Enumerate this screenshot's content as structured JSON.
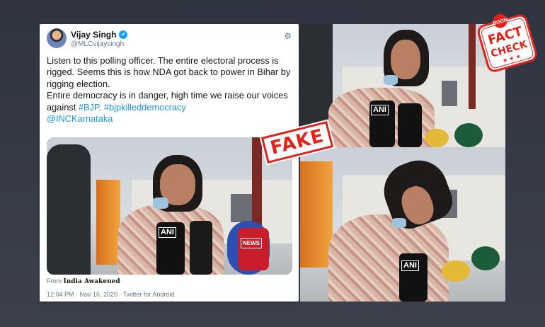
{
  "tweet": {
    "display_name": "Vijay Singh",
    "handle": "@MLCvijaysingh",
    "text_lines": [
      "Listen to this polling officer. The entire electoral process is rigged. Seems this is how NDA got back to power in Bihar by rigging election.",
      "Entire democracy is in danger, high time we raise our voices against "
    ],
    "hashtags": [
      "#BJP",
      "#bjpkilleddemocracy"
    ],
    "mention": "@INCKarnataka",
    "source_prefix": "From",
    "source_name": "India Awakened",
    "timestamp": "12:04 PM · Nov 16, 2020 · Twitter for Android"
  },
  "mic_labels": {
    "ani": "ANI",
    "news": "NEWS"
  },
  "stamp": {
    "fake": "FAKE"
  },
  "logo": {
    "boom": "BOOM",
    "fact": "FACT",
    "check": "CHECK"
  },
  "colors": {
    "brand_red": "#e0241b",
    "link_blue": "#1b95e0",
    "verified_blue": "#1da1f2"
  },
  "icons": [
    "verified-icon",
    "gear-icon",
    "star-icon"
  ]
}
